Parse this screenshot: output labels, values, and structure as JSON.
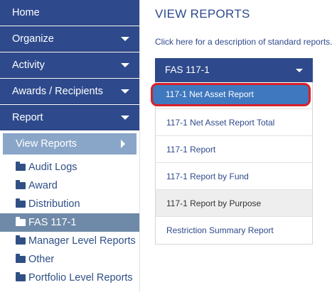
{
  "sidebar": {
    "nav": [
      {
        "label": "Home"
      },
      {
        "label": "Organize"
      },
      {
        "label": "Activity"
      },
      {
        "label": "Awards / Recipients"
      },
      {
        "label": "Report"
      }
    ],
    "subnav": {
      "label": "View Reports"
    },
    "folders": [
      {
        "label": "Audit Logs"
      },
      {
        "label": "Award"
      },
      {
        "label": "Distribution"
      },
      {
        "label": "FAS 117-1",
        "active": true
      },
      {
        "label": "Manager Level Reports"
      },
      {
        "label": "Other"
      },
      {
        "label": "Portfolio Level Reports"
      }
    ]
  },
  "main": {
    "title": "VIEW REPORTS",
    "desc_prefix": "Click",
    "desc_link": "here",
    "desc_suffix": "for a description of standard reports.",
    "dropdown": {
      "label": "FAS 117-1"
    },
    "menu": [
      {
        "label": "117-1 Net Asset Report",
        "selected": true
      },
      {
        "label": "117-1 Net Asset Report Total"
      },
      {
        "label": "117-1 Report"
      },
      {
        "label": "117-1 Report by Fund"
      },
      {
        "label": "117-1 Report by Purpose",
        "hover": true
      },
      {
        "label": "Restriction Summary Report"
      }
    ]
  },
  "colors": {
    "nav_bg": "#2e4a8c",
    "subnav_bg": "#89a6c8",
    "active_folder_bg": "#6f8aa8",
    "link": "#2e4a8c",
    "selected_item_bg": "#3f78be",
    "highlight_border": "#d8202a"
  },
  "icons": {
    "caret": "chevron-down-icon",
    "subnav_arrow": "chevron-right-icon",
    "folder": "folder-icon"
  }
}
